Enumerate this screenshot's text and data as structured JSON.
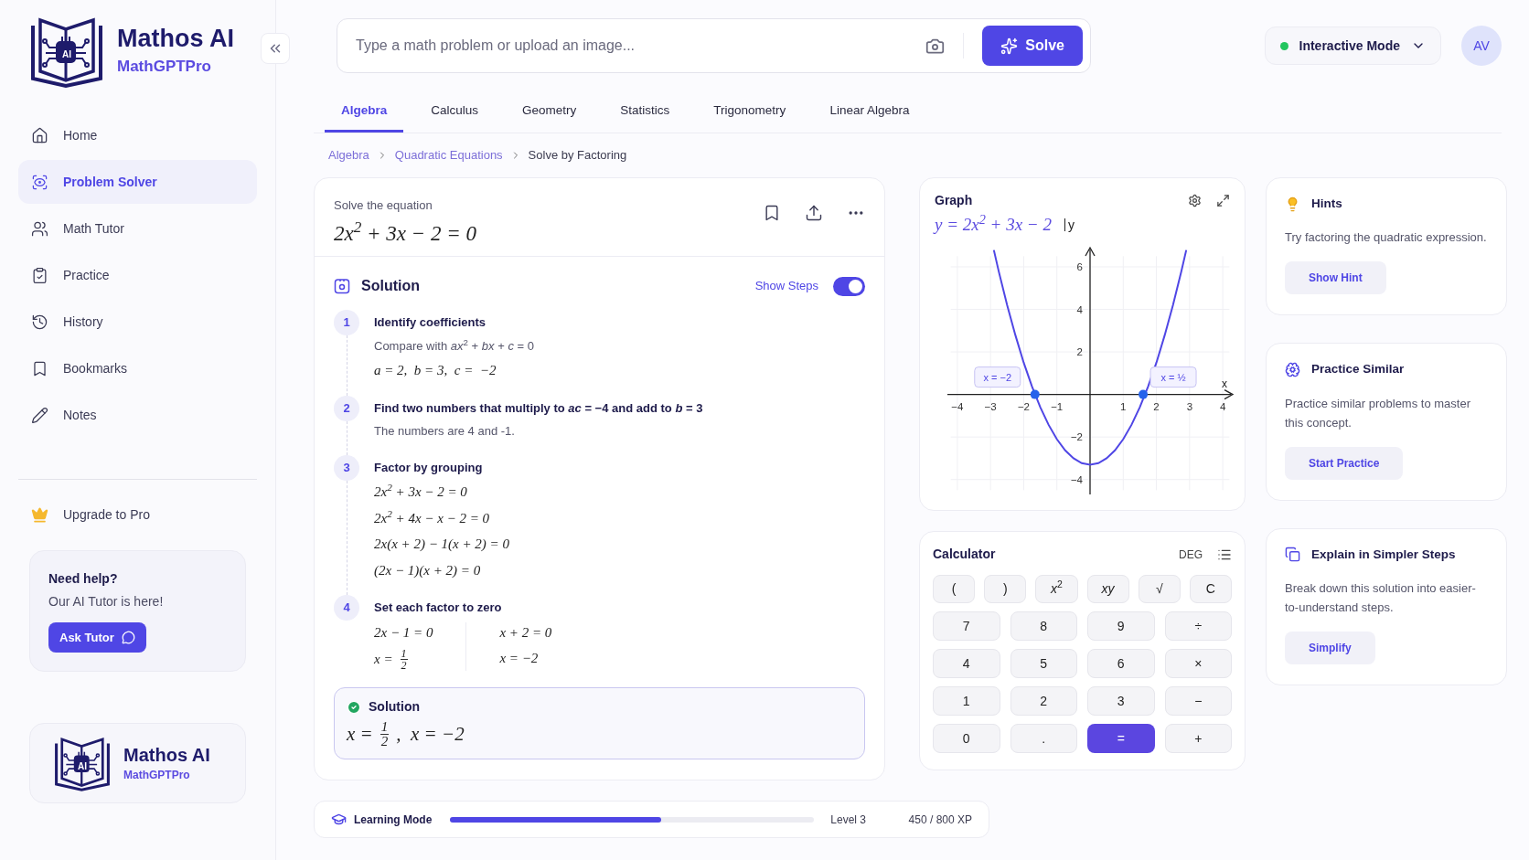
{
  "sidebar": {
    "logo": {
      "chip_text": "AI",
      "title": "Mathos AI",
      "subtitle": "MathGPTPro"
    },
    "items": [
      {
        "label": "Home",
        "selected": false
      },
      {
        "label": "Problem Solver",
        "selected": true
      },
      {
        "label": "Math Tutor",
        "selected": false
      },
      {
        "label": "Practice",
        "selected": false
      },
      {
        "label": "History",
        "selected": false
      },
      {
        "label": "Bookmarks",
        "selected": false
      },
      {
        "label": "Notes",
        "selected": false
      }
    ],
    "upgrade": "Upgrade to Pro",
    "help_card": {
      "title": "Need help?",
      "text": "Our AI Tutor is here!",
      "button": "Ask Tutor"
    },
    "footer_logo": {
      "chip_text": "AI",
      "title": "Mathos AI",
      "subtitle": "MathGPTPro"
    }
  },
  "search": {
    "placeholder": "Type a math problem or upload an image...",
    "button": "Solve"
  },
  "mode_menu": {
    "label": "Interactive Mode"
  },
  "avatar": "AV",
  "tabs": [
    {
      "label": "Algebra",
      "selected": true
    },
    {
      "label": "Calculus",
      "selected": false
    },
    {
      "label": "Geometry",
      "selected": false
    },
    {
      "label": "Statistics",
      "selected": false
    },
    {
      "label": "Trigonometry",
      "selected": false
    },
    {
      "label": "Linear Algebra",
      "selected": false
    }
  ],
  "breadcrumb": [
    {
      "label": "Algebra",
      "current": false
    },
    {
      "label": "Quadratic Equations",
      "current": false
    },
    {
      "label": "Solve by Factoring",
      "current": true
    }
  ],
  "problem": {
    "prompt": "Solve the equation",
    "equation": "2x$^{2}$ + 3x − 2 = 0"
  },
  "solution": {
    "title": "Solution",
    "show_steps": {
      "label": "Show Steps",
      "on": true
    },
    "steps": [
      {
        "number": "1",
        "title": "Identify coefficients",
        "columns": [
          [
            {
              "kind": "text",
              "text": "Compare with *ax*$^{2}$ + *bx* + *c* = 0"
            },
            {
              "kind": "math",
              "text": "a = 2,  b = 3,  c =  −2"
            }
          ]
        ]
      },
      {
        "number": "2",
        "title": "Find two numbers that multiply to *ac* = −4 and add to *b* = 3",
        "columns": [
          [
            {
              "kind": "text",
              "text": "The numbers are 4 and -1."
            }
          ]
        ]
      },
      {
        "number": "3",
        "title": "Factor by grouping",
        "columns": [
          [
            {
              "kind": "math",
              "text": "2x$^{2}$ + 3x − 2 = 0"
            },
            {
              "kind": "math",
              "text": "2x$^{2}$ + 4x − x − 2 = 0"
            },
            {
              "kind": "math",
              "text": "2x(x + 2) − 1(x + 2) = 0"
            },
            {
              "kind": "math",
              "text": "(2x − 1)(x + 2) = 0"
            }
          ]
        ]
      },
      {
        "number": "4",
        "title": "Set each factor to zero",
        "columns": [
          [
            {
              "kind": "math",
              "text": "2x − 1 = 0"
            },
            {
              "kind": "fraction",
              "before": "x =",
              "num": "1",
              "den": "2"
            }
          ],
          [
            {
              "kind": "math",
              "text": "x + 2 = 0"
            },
            {
              "kind": "math",
              "text": "x = −2"
            }
          ]
        ]
      }
    ],
    "result": {
      "title": "Solution",
      "line": {
        "kind": "fraction",
        "before": "x =",
        "num": "1",
        "den": "2",
        "after": ",  x = −2"
      }
    }
  },
  "graph": {
    "title": "Graph",
    "chart_data": {
      "type": "line",
      "title": "y = 2x$^{2}$ + 3x − 2",
      "xlabel": "x",
      "ylabel": "y",
      "grid": true,
      "x": [
        -2.9,
        -2.75,
        -2.5,
        -2.25,
        -2,
        -1.75,
        -1.5,
        -1.25,
        -1,
        -0.75,
        -0.5,
        -0.25,
        0,
        0.25,
        0.5,
        0.75,
        1,
        1.25,
        1.5,
        1.75,
        2,
        2.25,
        2.5,
        2.75,
        2.9
      ],
      "series": [
        {
          "color": "#4f46e5",
          "values": [
            6.79,
            5.78,
            4.2,
            2.78,
            1.5,
            0.38,
            -0.6,
            -1.43,
            -2.1,
            -2.63,
            -3.0,
            -3.23,
            -3.3,
            -3.23,
            -3.0,
            -2.63,
            -2.1,
            -1.43,
            -0.6,
            0.38,
            1.5,
            2.78,
            4.2,
            5.78,
            6.79
          ]
        }
      ],
      "xlim": [
        -4.3,
        4.3
      ],
      "ylim": [
        -4.7,
        6.9
      ],
      "xticks": [
        {
          "value": -4,
          "label": "−4"
        },
        {
          "value": -3,
          "label": "−3"
        },
        {
          "value": -2,
          "label": "−2"
        },
        {
          "value": -1,
          "label": "−1"
        },
        {
          "value": 1,
          "label": "1"
        },
        {
          "value": 2,
          "label": "2"
        },
        {
          "value": 3,
          "label": "3"
        },
        {
          "value": 4,
          "label": "4"
        }
      ],
      "yticks": [
        {
          "value": -4,
          "label": "−4"
        },
        {
          "value": -2,
          "label": "−2"
        },
        {
          "value": 2,
          "label": "2"
        },
        {
          "value": 4,
          "label": "4"
        },
        {
          "value": 6,
          "label": "6"
        }
      ],
      "annotations": [
        {
          "text": "x = −2",
          "x": -1.66,
          "y": 0
        },
        {
          "text": "x = ½",
          "x": 1.6,
          "y": 0
        }
      ]
    }
  },
  "calculator": {
    "title": "Calculator",
    "angle_mode": "DEG",
    "rows": [
      [
        {
          "label": "(",
          "kind": "function"
        },
        {
          "label": ")",
          "kind": "function"
        },
        {
          "label": "*x*$^{2}$",
          "kind": "function"
        },
        {
          "label": "*xy*",
          "kind": "function"
        },
        {
          "label": "√",
          "kind": "function"
        },
        {
          "label": "C",
          "kind": "function"
        }
      ],
      [
        {
          "label": "7",
          "kind": "digit"
        },
        {
          "label": "8",
          "kind": "digit"
        },
        {
          "label": "9",
          "kind": "digit"
        },
        {
          "label": "÷",
          "kind": "operator"
        }
      ],
      [
        {
          "label": "4",
          "kind": "digit"
        },
        {
          "label": "5",
          "kind": "digit"
        },
        {
          "label": "6",
          "kind": "digit"
        },
        {
          "label": "×",
          "kind": "operator"
        }
      ],
      [
        {
          "label": "1",
          "kind": "digit"
        },
        {
          "label": "2",
          "kind": "digit"
        },
        {
          "label": "3",
          "kind": "digit"
        },
        {
          "label": "−",
          "kind": "operator"
        }
      ],
      [
        {
          "label": "0",
          "kind": "digit"
        },
        {
          "label": ".",
          "kind": "digit"
        },
        {
          "label": "=",
          "kind": "equals"
        },
        {
          "label": "+",
          "kind": "operator"
        }
      ]
    ]
  },
  "side_cards": [
    {
      "title": "Hints",
      "text": "Try factoring the quadratic expression.",
      "button": "Show Hint"
    },
    {
      "title": "Practice Similar",
      "text": "Practice similar problems to master this concept.",
      "button": "Start Practice"
    },
    {
      "title": "Explain in Simpler Steps",
      "text": "Break down this solution into easier-to-understand steps.",
      "button": "Simplify"
    }
  ],
  "learning": {
    "label": "Learning Mode",
    "level": 0.58,
    "level_text": "Level 3",
    "xp": "450 / 800 XP"
  }
}
